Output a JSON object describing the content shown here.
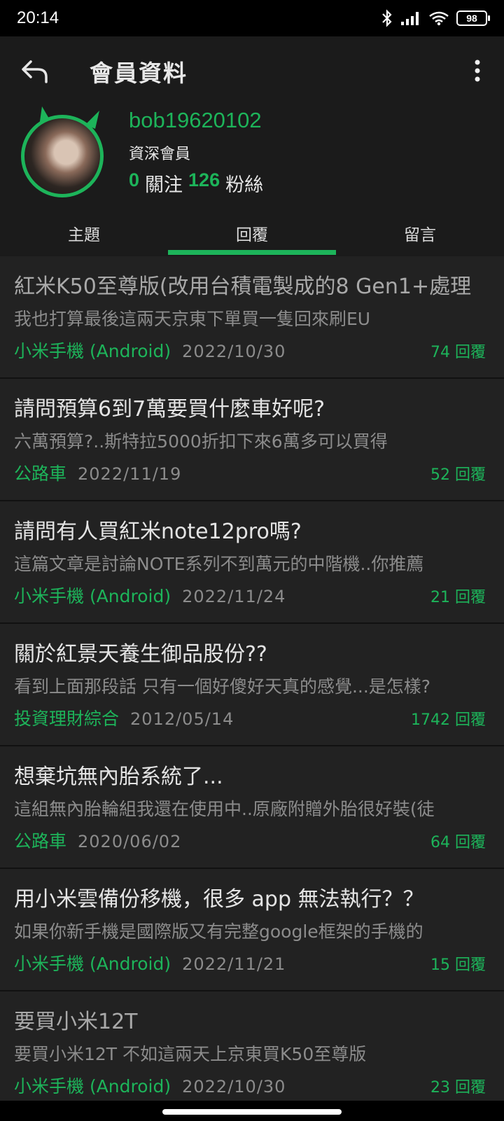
{
  "status": {
    "time": "20:14",
    "battery": "98"
  },
  "header": {
    "title": "會員資料"
  },
  "profile": {
    "username": "bob19620102",
    "level": "資深會員",
    "following_count": "0",
    "following_label": "關注",
    "followers_count": "126",
    "followers_label": "粉絲"
  },
  "tabs": [
    {
      "label": "主題"
    },
    {
      "label": "回覆"
    },
    {
      "label": "留言"
    }
  ],
  "posts": [
    {
      "title": "紅米K50至尊版(改用台積電製成的8 Gen1+處理",
      "excerpt": "我也打算最後這兩天京東下單買一隻回來刷EU",
      "forum": "小米手機 (Android)",
      "date": "2022/10/30",
      "replies": "74 回覆"
    },
    {
      "title": "請問預算6到7萬要買什麼車好呢?",
      "excerpt": "六萬預算?..斯特拉5000折扣下來6萬多可以買得",
      "forum": "公路車",
      "date": "2022/11/19",
      "replies": "52 回覆"
    },
    {
      "title": "請問有人買紅米note12pro嗎?",
      "excerpt": "這篇文章是討論NOTE系列不到萬元的中階機..你推薦",
      "forum": "小米手機 (Android)",
      "date": "2022/11/24",
      "replies": "21 回覆"
    },
    {
      "title": "關於紅景天養生御品股份??",
      "excerpt": "看到上面那段話 只有一個好傻好天真的感覺...是怎樣?",
      "forum": "投資理財綜合",
      "date": "2012/05/14",
      "replies": "1742 回覆"
    },
    {
      "title": "想棄坑無內胎系統了...",
      "excerpt": "這組無內胎輪組我還在使用中..原廠附贈外胎很好裝(徒",
      "forum": "公路車",
      "date": "2020/06/02",
      "replies": "64 回覆"
    },
    {
      "title": "用小米雲備份移機，很多 app 無法執行？？",
      "excerpt": "如果你新手機是國際版又有完整google框架的手機的",
      "forum": "小米手機 (Android)",
      "date": "2022/11/21",
      "replies": "15 回覆"
    },
    {
      "title": "要買小米12T",
      "excerpt": "要買小米12T 不如這兩天上京東買K50至尊版",
      "forum": "小米手機 (Android)",
      "date": "2022/10/30",
      "replies": "23 回覆"
    }
  ]
}
